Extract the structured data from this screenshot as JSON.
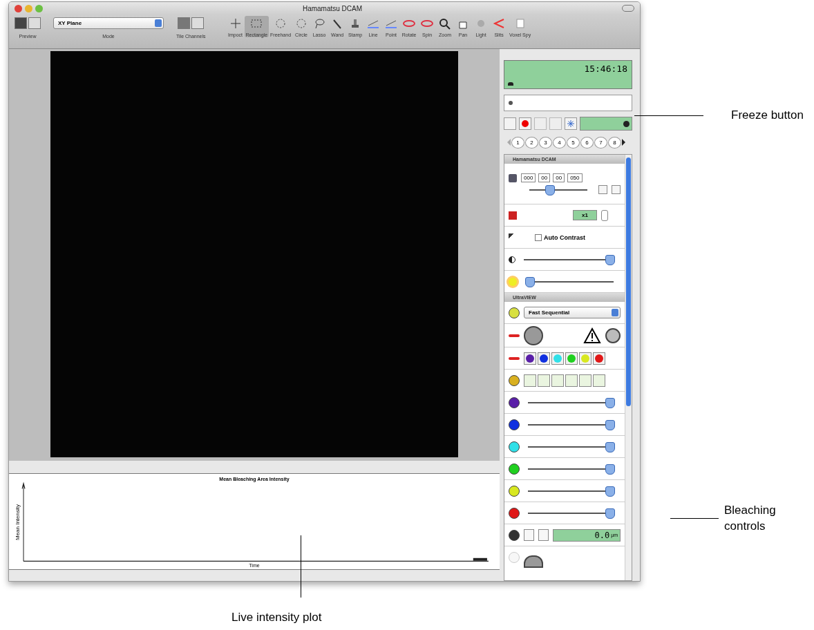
{
  "window": {
    "title": "Hamamatsu DCAM"
  },
  "toolbar": {
    "preview_label": "Preview",
    "mode": {
      "value": "XY Plane",
      "label": "Mode"
    },
    "tile_label": "Tile Channels",
    "tools": [
      {
        "label": "Impoct",
        "selected": false
      },
      {
        "label": "Rectangle",
        "selected": true
      },
      {
        "label": "Freehand",
        "selected": false
      },
      {
        "label": "Circle",
        "selected": false
      },
      {
        "label": "Lasso",
        "selected": false
      },
      {
        "label": "Wand",
        "selected": false
      },
      {
        "label": "Stamp",
        "selected": false
      },
      {
        "label": "Line",
        "selected": false
      },
      {
        "label": "Point",
        "selected": false
      },
      {
        "label": "Rotate",
        "selected": false
      },
      {
        "label": "Spin",
        "selected": false
      },
      {
        "label": "Zoom",
        "selected": false
      },
      {
        "label": "Pan",
        "selected": false
      },
      {
        "label": "Light",
        "selected": false
      },
      {
        "label": "Slits",
        "selected": false
      },
      {
        "label": "Voxel Spy",
        "selected": false
      }
    ]
  },
  "plot": {
    "title": "Mean Bleaching Area Intensity",
    "ylabel": "Mean Intensity",
    "xlabel": "Time"
  },
  "panel": {
    "clock": "15:46:18",
    "channel_numbers": [
      "1",
      "2",
      "3",
      "4",
      "5",
      "6",
      "7",
      "8"
    ],
    "camera": {
      "title": "Hamamatsu DCAM",
      "exposure": [
        "000",
        "00",
        "00",
        "050"
      ],
      "exposure_slider": {
        "level": 0.35
      },
      "gain": "x1",
      "auto_contrast": {
        "label": "Auto Contrast",
        "checked": false
      },
      "contrast": {
        "level": 0.95
      },
      "brightness": {
        "level": 0.05
      }
    },
    "ultraview": {
      "title": "UltraVIEW",
      "mode": "Fast Sequential",
      "lasers": [
        {
          "color": "#5a1fa8"
        },
        {
          "color": "#1030e0"
        },
        {
          "color": "#30e0e8"
        },
        {
          "color": "#20d020"
        },
        {
          "color": "#d8e820"
        },
        {
          "color": "#e01818"
        }
      ],
      "channels": [
        {
          "color": "#5a1fa8",
          "level": 0.95
        },
        {
          "color": "#1030e0",
          "level": 0.95
        },
        {
          "color": "#30e0e8",
          "level": 0.95
        },
        {
          "color": "#20d020",
          "level": 0.95
        },
        {
          "color": "#d8e820",
          "level": 0.95
        },
        {
          "color": "#e01818",
          "level": 0.95
        }
      ],
      "focus": {
        "value": "0.0",
        "unit": "µm"
      }
    }
  },
  "annotations": [
    {
      "text": "Freeze button"
    },
    {
      "text": "Bleaching controls"
    },
    {
      "text": "Live intensity plot"
    }
  ]
}
